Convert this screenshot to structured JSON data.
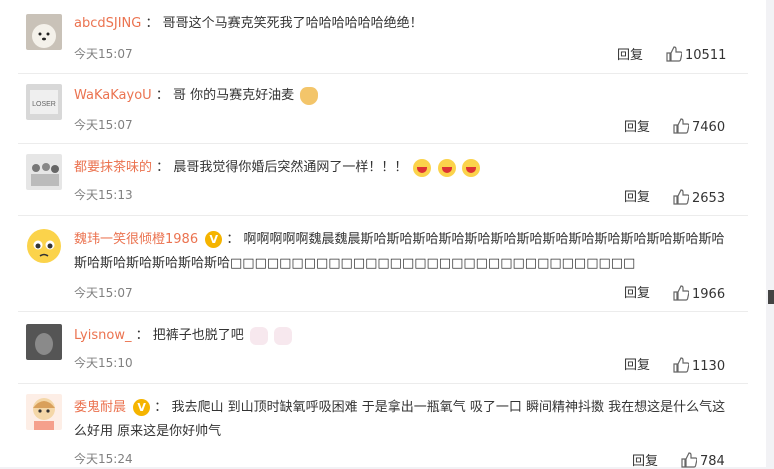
{
  "colors": {
    "username": "#eb7350",
    "badge": "#f5b400",
    "time": "#808080"
  },
  "comments": [
    {
      "user": "abcdSJING",
      "sep": "：",
      "text": "哥哥这个马赛克笑死我了哈哈哈哈哈哈绝绝！",
      "time": "今天15:07",
      "reply": "回复",
      "likes": "10511",
      "avatar_icon": "dog-avatar"
    },
    {
      "user": "WaKaKayoU",
      "sep": "：",
      "text": "哥 你的马赛克好油麦",
      "time": "今天15:07",
      "reply": "回复",
      "likes": "7460",
      "avatar_icon": "loser-avatar",
      "emoji": [
        "doge-emoji"
      ]
    },
    {
      "user": "都要抹茶味的",
      "sep": "：",
      "text": "晨哥我觉得你婚后突然通网了一样！！！",
      "time": "今天15:13",
      "reply": "回复",
      "likes": "2653",
      "avatar_icon": "group-photo-avatar",
      "emoji": [
        "laugh-emoji",
        "laugh-emoji",
        "laugh-emoji"
      ]
    },
    {
      "user": "魏玮一笑很倾橙1986",
      "sep": "：",
      "text": "啊啊啊啊啊魏晨魏晨斯哈斯哈斯哈斯哈斯哈斯哈斯哈斯哈斯哈斯哈斯哈斯哈斯哈斯哈斯哈斯哈斯哈斯哈斯哈斯哈□□□□□□□□□□□□□□□□□□□□□□□□□□□□□□□□□",
      "time": "今天15:07",
      "reply": "回复",
      "likes": "1966",
      "avatar_icon": "crying-emoji-avatar",
      "verified": "V"
    },
    {
      "user": "Lyisnow_",
      "sep": "：",
      "text": "把裤子也脱了吧",
      "time": "今天15:10",
      "reply": "回复",
      "likes": "1130",
      "avatar_icon": "dark-photo-avatar",
      "emoji": [
        "bunny-emoji",
        "bunny-emoji"
      ]
    },
    {
      "user": "委鬼耐晨",
      "sep": "：",
      "text": "我去爬山 到山顶时缺氧呼吸困难 于是拿出一瓶氧气 吸了一口 瞬间精神抖擞 我在想这是什么气这么好用 原来这是你好帅气",
      "time": "今天15:24",
      "reply": "回复",
      "likes": "784",
      "avatar_icon": "cartoon-girl-avatar",
      "verified": "V"
    }
  ]
}
